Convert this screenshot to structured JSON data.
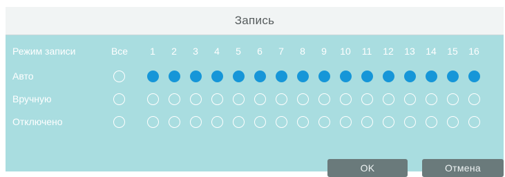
{
  "dialog": {
    "title": "Запись"
  },
  "table": {
    "header_label": "Режим записи",
    "all_label": "Все",
    "channels": [
      "1",
      "2",
      "3",
      "4",
      "5",
      "6",
      "7",
      "8",
      "9",
      "10",
      "11",
      "12",
      "13",
      "14",
      "15",
      "16"
    ],
    "rows": [
      {
        "label": "Авто",
        "all_checked": false,
        "checked": [
          true,
          true,
          true,
          true,
          true,
          true,
          true,
          true,
          true,
          true,
          true,
          true,
          true,
          true,
          true,
          true
        ]
      },
      {
        "label": "Вручную",
        "all_checked": false,
        "checked": [
          false,
          false,
          false,
          false,
          false,
          false,
          false,
          false,
          false,
          false,
          false,
          false,
          false,
          false,
          false,
          false
        ]
      },
      {
        "label": "Отключено",
        "all_checked": false,
        "checked": [
          false,
          false,
          false,
          false,
          false,
          false,
          false,
          false,
          false,
          false,
          false,
          false,
          false,
          false,
          false,
          false
        ]
      }
    ]
  },
  "buttons": {
    "ok": "OK",
    "cancel": "Отмена"
  },
  "colors": {
    "background": "#a9dde0",
    "title_bar": "#f1f4f4",
    "radio_checked": "#1696d8",
    "button": "#6a7a7b"
  }
}
